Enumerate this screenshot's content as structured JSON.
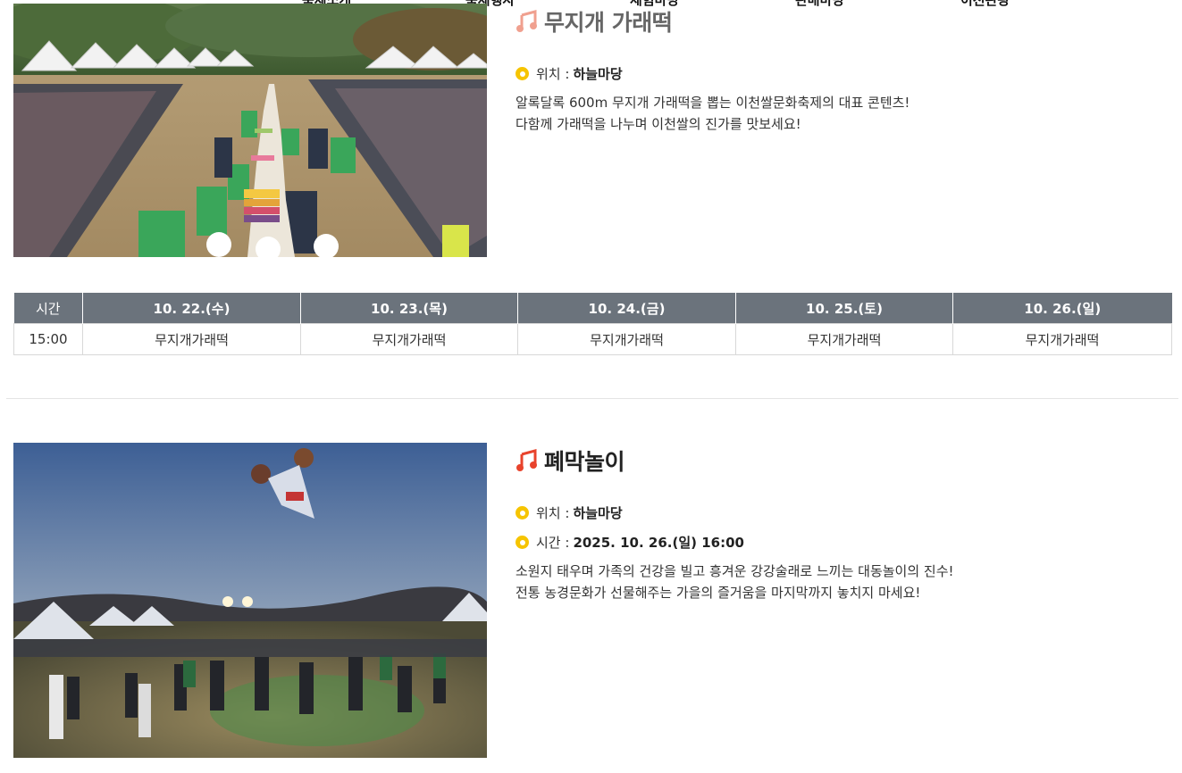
{
  "nav": {
    "items": [
      "축제소개",
      "축제행사",
      "체험마당",
      "판매마당",
      "이천관광"
    ]
  },
  "sections": [
    {
      "title": "무지개 가래떡",
      "location_label": "위치 :",
      "location_value": "하늘마당",
      "desc_lines": [
        "알록달록 600m 무지개 가래떡을 뽑는 이천쌀문화축제의 대표 콘텐츠!",
        "다함께 가래떡을 나누며 이천쌀의 진가를 맛보세요!"
      ]
    },
    {
      "title": "폐막놀이",
      "location_label": "위치 :",
      "location_value": "하늘마당",
      "time_label": "시간 :",
      "time_value": "2025. 10. 26.(일) 16:00",
      "desc_lines": [
        "소원지 태우며 가족의 건강을 빌고 흥겨운 강강술래로 느끼는 대동놀이의 진수!",
        "전통 농경문화가 선물해주는 가을의 즐거움을 마지막까지 놓치지 마세요!"
      ]
    }
  ],
  "schedule": {
    "headers": [
      "시간",
      "10. 22.(수)",
      "10. 23.(목)",
      "10. 24.(금)",
      "10. 25.(토)",
      "10. 26.(일)"
    ],
    "rows": [
      [
        "15:00",
        "무지개가래떡",
        "무지개가래떡",
        "무지개가래떡",
        "무지개가래떡",
        "무지개가래떡"
      ]
    ]
  },
  "colors": {
    "accent_note": "#e8432c",
    "dot": "#f6c400",
    "table_header": "#6b737c"
  }
}
